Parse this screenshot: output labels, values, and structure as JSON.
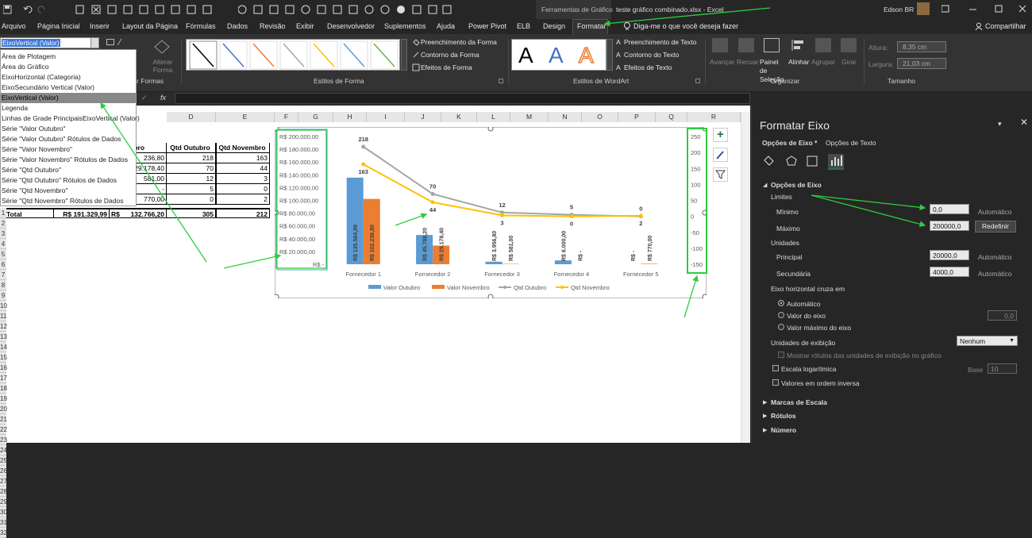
{
  "titlebar": {
    "contextual_tools": "Ferramentas de Gráfico",
    "filename": "teste gráfico combinado.xlsx  -  Excel",
    "user": "Edson BR"
  },
  "tabs": [
    "Arquivo",
    "Página Inicial",
    "Inserir",
    "Layout da Página",
    "Fórmulas",
    "Dados",
    "Revisão",
    "Exibir",
    "Desenvolvedor",
    "Suplementos",
    "Ajuda",
    "Power Pivot",
    "ELB",
    "Design",
    "Formatar"
  ],
  "tell_me": "Diga-me o que você deseja fazer",
  "share": "Compartilhar",
  "ribbon": {
    "name_box": "EixoVertical (Valor)",
    "alterar_forma": "Alterar Forma",
    "formas_label": "r Formas",
    "estilos_forma": "Estilos de Forma",
    "preenchimento_forma": "Preenchimento da Forma",
    "contorno_forma": "Contorno da Forma",
    "efeitos_forma": "Efeitos de Forma",
    "wordart_label": "Estilos de WordArt",
    "preenchimento_texto": "Preenchimento de Texto",
    "contorno_texto": "Contorno do Texto",
    "efeitos_texto": "Efeitos de Texto",
    "avancar": "Avançar",
    "recuar": "Recuar",
    "painel_selecao": "Painel de Seleção",
    "alinhar": "Alinhar",
    "agrupar": "Agrupar",
    "girar": "Girar",
    "organizar": "Organizar",
    "altura_label": "Altura:",
    "altura": "8,35 cm",
    "largura_label": "Largura:",
    "largura": "21,03 cm",
    "tamanho": "Tamanho",
    "fx": "fx"
  },
  "dropdown": [
    "Área de Plotagem",
    "Área do Gráfico",
    "EixoHorizontal (Categoria)",
    "EixoSecundário Vertical (Valor)",
    "EixoVertical (Valor)",
    "Legenda",
    "Linhas de Grade PrincipaisEixoVertical (Valor)",
    "Série \"Valor Outubro\"",
    "Série \"Valor Outubro\" Rótulos de Dados",
    "Série \"Valor Novembro\"",
    "Série \"Valor Novembro\" Rótulos de Dados",
    "Série \"Qtd Outubro\"",
    "Série \"Qtd Outubro\" Rótulos de Dados",
    "Série \"Qtd Novembro\"",
    "Série \"Qtd Novembro\" Rótulos de Dados"
  ],
  "sheet": {
    "columns": [
      "D",
      "E",
      "F",
      "G",
      "H",
      "I",
      "J",
      "K",
      "L",
      "M",
      "N",
      "O",
      "P",
      "Q",
      "R"
    ],
    "row_numbers": [
      "1",
      "2",
      "3",
      "4",
      "5",
      "6",
      "7",
      "8",
      "9",
      "10",
      "11",
      "12",
      "13",
      "14",
      "15",
      "16",
      "17",
      "18",
      "19",
      "20",
      "21",
      "22",
      "23",
      "24",
      "25",
      "26",
      "27",
      "28",
      "29",
      "30",
      "31",
      "32"
    ],
    "headers": [
      "Novembro",
      "Qtd Outubro",
      "Qtd Novembro"
    ],
    "rows": [
      [
        "236,80",
        "218",
        "163"
      ],
      [
        "29.178,40",
        "70",
        "44"
      ],
      [
        "581,00",
        "12",
        "3"
      ],
      [
        "-",
        "5",
        "0"
      ],
      [
        "770,00",
        "0",
        "2"
      ]
    ],
    "total_label": "Total",
    "total": [
      "R$ 191.329,99",
      "R$",
      "132.766,20",
      "305",
      "212"
    ]
  },
  "chart_data": {
    "type": "bar",
    "categories": [
      "Fornecedor 1",
      "Fornecedor 2",
      "Fornecedor 3",
      "Fornecedor 4",
      "Fornecedor 5"
    ],
    "series": [
      {
        "name": "Valor Outubro",
        "type": "bar",
        "axis": "primary",
        "color": "#5b9bd5",
        "values": [
          135584.99,
          45788.2,
          3956.8,
          6000.0,
          0
        ],
        "labels": [
          "R$ 135.584,99",
          "R$ 45.788,20",
          "R$ 3.956,80",
          "R$ 6.000,00",
          "R$ -"
        ]
      },
      {
        "name": "Valor Novembro",
        "type": "bar",
        "axis": "primary",
        "color": "#ed7d31",
        "values": [
          102236.8,
          29178.4,
          581.0,
          0,
          770.0
        ],
        "labels": [
          "R$ 102.236,80",
          "R$ 29.178,40",
          "R$ 581,00",
          "R$ -",
          "R$ 770,00"
        ]
      },
      {
        "name": "Qtd Outubro",
        "type": "line",
        "axis": "secondary",
        "color": "#a5a5a5",
        "values": [
          218,
          70,
          12,
          5,
          0
        ]
      },
      {
        "name": "Qtd Novembro",
        "type": "line",
        "axis": "secondary",
        "color": "#ffc000",
        "values": [
          163,
          44,
          3,
          0,
          2
        ]
      }
    ],
    "primary_ticks": [
      "R$ 200.000,00",
      "R$ 180.000,00",
      "R$ 160.000,00",
      "R$ 140.000,00",
      "R$ 120.000,00",
      "R$ 100.000,00",
      "R$ 80.000,00",
      "R$ 60.000,00",
      "R$ 40.000,00",
      "R$ 20.000,00",
      "R$ -"
    ],
    "secondary_ticks": [
      "250",
      "200",
      "150",
      "100",
      "50",
      "0",
      "-50",
      "-100",
      "-150"
    ],
    "ylim": [
      0,
      200000
    ],
    "y2lim": [
      -150,
      250
    ],
    "legend": "bottom"
  },
  "pane": {
    "title": "Formatar Eixo",
    "tab_axis": "Opções de Eixo",
    "tab_text": "Opções de Texto",
    "section": "Opções de Eixo",
    "limites": "Limites",
    "minimo": "Mínimo",
    "minimo_val": "0,0",
    "automatico": "Automático",
    "maximo": "Máximo",
    "maximo_val": "200000,0",
    "redefinir": "Redefinir",
    "unidades": "Unidades",
    "principal": "Principal",
    "principal_val": "20000,0",
    "secundaria": "Secundária",
    "secundaria_val": "4000,0",
    "cruza": "Eixo horizontal cruza em",
    "r_auto": "Automático",
    "r_valor": "Valor do eixo",
    "r_valor_val": "0,0",
    "r_max": "Valor máximo do eixo",
    "unid_exib": "Unidades de exibição",
    "unid_exib_val": "Nenhum",
    "mostrar_rotulos": "Mostrar rótulos das unidades de exibição no gráfico",
    "escala_log": "Escala logarítmica",
    "base": "Base",
    "base_val": "10",
    "inversa": "Valores em ordem inversa",
    "marcas": "Marcas de Escala",
    "rotulos": "Rótulos",
    "numero": "Número"
  }
}
